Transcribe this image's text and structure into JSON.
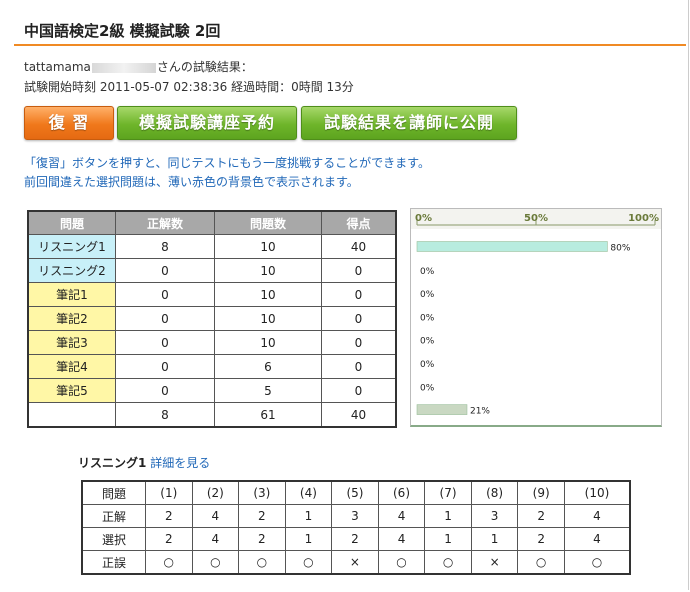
{
  "page_title": "中国語検定2級 模擬試験 2回",
  "user": {
    "name_prefix": "tattamama",
    "suffix": "さんの試験結果："
  },
  "timing": {
    "text": "試験開始時刻 2011-05-07 02:38:36 経過時間：0時間 13分"
  },
  "buttons": {
    "review": "復 習",
    "reserve": "模擬試験講座予約",
    "publish": "試験結果を講師に公開"
  },
  "notes": {
    "line1": "「復習」ボタンを押すと、同じテストにもう一度挑戦することができます。",
    "line2": "前回間違えた選択問題は、薄い赤色の背景色で表示されます。"
  },
  "score_table": {
    "headers": [
      "問題",
      "正解数",
      "問題数",
      "得点"
    ],
    "rows": [
      {
        "name": "リスニング1",
        "correct": "8",
        "total": "10",
        "score": "40",
        "kind": "listen"
      },
      {
        "name": "リスニング2",
        "correct": "0",
        "total": "10",
        "score": "0",
        "kind": "listen"
      },
      {
        "name": "筆記1",
        "correct": "0",
        "total": "10",
        "score": "0",
        "kind": "write"
      },
      {
        "name": "筆記2",
        "correct": "0",
        "total": "10",
        "score": "0",
        "kind": "write"
      },
      {
        "name": "筆記3",
        "correct": "0",
        "total": "10",
        "score": "0",
        "kind": "write"
      },
      {
        "name": "筆記4",
        "correct": "0",
        "total": "6",
        "score": "0",
        "kind": "write"
      },
      {
        "name": "筆記5",
        "correct": "0",
        "total": "5",
        "score": "0",
        "kind": "write"
      }
    ],
    "total_row": {
      "name": "",
      "correct": "8",
      "total": "61",
      "score": "40"
    }
  },
  "chart_data": {
    "type": "bar",
    "orientation": "horizontal",
    "axis_ticks": [
      "0%",
      "50%",
      "100%"
    ],
    "xlim": [
      0,
      100
    ],
    "values": [
      80,
      0,
      0,
      0,
      0,
      0,
      0,
      21
    ],
    "labels": [
      "80%",
      "0%",
      "0%",
      "0%",
      "0%",
      "0%",
      "0%",
      "21%"
    ],
    "grid": false,
    "colors": {
      "section_bar": "#b8ecdf",
      "total_bar": "#c9d8c2"
    }
  },
  "detail": {
    "section": "リスニング1",
    "link": "詳細を見る",
    "row_labels": {
      "question": "問題",
      "answer": "正解",
      "selected": "選択",
      "result": "正誤"
    },
    "questions": [
      "(1)",
      "(2)",
      "(3)",
      "(4)",
      "(5)",
      "(6)",
      "(7)",
      "(8)",
      "(9)",
      "(10)"
    ],
    "answers": [
      "2",
      "4",
      "2",
      "1",
      "3",
      "4",
      "1",
      "3",
      "2",
      "4"
    ],
    "selected": [
      "2",
      "4",
      "2",
      "1",
      "2",
      "4",
      "1",
      "1",
      "2",
      "4"
    ],
    "results": [
      "○",
      "○",
      "○",
      "○",
      "×",
      "○",
      "○",
      "×",
      "○",
      "○"
    ]
  }
}
